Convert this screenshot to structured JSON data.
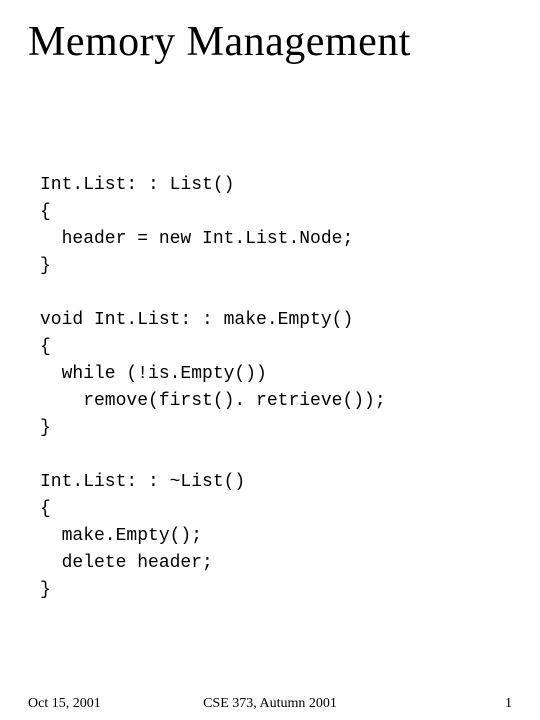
{
  "title": "Memory Management",
  "code": {
    "l1": "Int.List: : List()",
    "l2": "{",
    "l3": "  header = new Int.List.Node;",
    "l4": "}",
    "l5": "",
    "l6": "void Int.List: : make.Empty()",
    "l7": "{",
    "l8": "  while (!is.Empty())",
    "l9": "    remove(first(). retrieve());",
    "l10": "}",
    "l11": "",
    "l12": "Int.List: : ~List()",
    "l13": "{",
    "l14": "  make.Empty();",
    "l15": "  delete header;",
    "l16": "}"
  },
  "footer": {
    "date": "Oct 15, 2001",
    "course": "CSE 373, Autumn 2001",
    "page": "1"
  }
}
